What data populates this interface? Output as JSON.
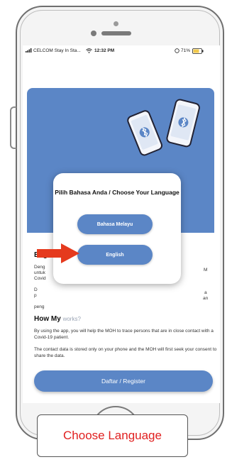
{
  "status_bar": {
    "carrier": "CELCOM Stay In Sta...",
    "time": "12:32 PM",
    "battery": "71%"
  },
  "background": {
    "heading": "Bag",
    "line1": "Deng",
    "line2": "untuk",
    "line3": "Covid",
    "line4": "D",
    "line5": "p",
    "line6": "peng",
    "right1": "M",
    "right2": "a",
    "right3": "an",
    "how_heading": "How My",
    "how_heading_tail": "works?",
    "paragraph1": "By using the app, you will help the MOH to trace persons that are in close contact with a Covid-19 patient.",
    "paragraph2": "The contact data is stored only on your phone and the MOH will first seek your consent to share the data.",
    "register_button": "Daftar / Register"
  },
  "dialog": {
    "title": "Pilih Bahasa Anda / Choose Your Language",
    "options": [
      {
        "label": "Bahasa Melayu"
      },
      {
        "label": "English"
      }
    ]
  },
  "caption": "Choose Language",
  "colors": {
    "primary_blue": "#5b86c6",
    "caption_red": "#e02020",
    "arrow_red": "#e53a1e"
  }
}
